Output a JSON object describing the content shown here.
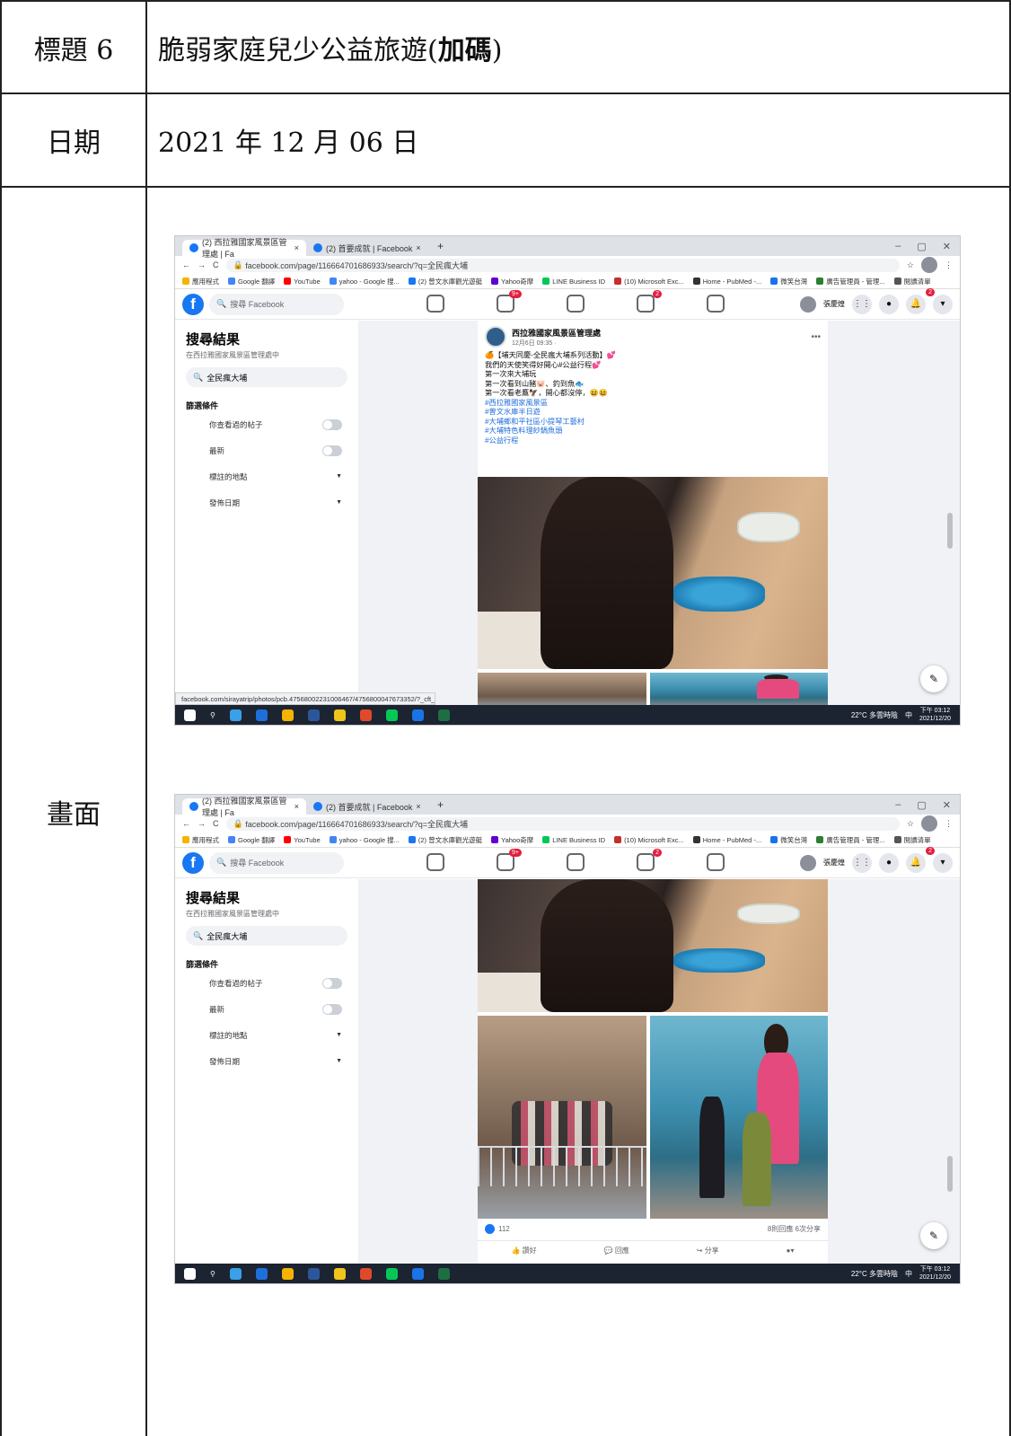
{
  "rows": {
    "title_label": "標題 6",
    "title_value_main": "脆弱家庭兒少公益旅遊(",
    "title_value_bold": "加碼",
    "title_value_end": ")",
    "date_label": "日期",
    "date_value": "2021 年 12 月 06 日",
    "screen_label": "畫面"
  },
  "browser": {
    "tab1": "(2) 西拉雅國家風景區管理處 | Fa",
    "tab2": "(2) 首要成就 | Facebook",
    "url_1": "facebook.com/page/116664701686933/search/?q=全民瘋大埔",
    "url_2": "facebook.com/page/116664701686933/search/?q=全民瘋大埔",
    "bookmarks": [
      "應用程式",
      "Google 翻譯",
      "YouTube",
      "yahoo - Google 搜...",
      "(2) 曾文水庫觀光遊艇",
      "Yahoo奇摩",
      "LINE Business ID",
      "(10) Microsoft Exc...",
      "Home - PubMed -...",
      "微笑台灣",
      "廣告管理員 - 管理...",
      "閱讀清單"
    ],
    "bookmark_colors": [
      "#f4b400",
      "#4285f4",
      "#ff0000",
      "#4285f4",
      "#1877f2",
      "#6001d2",
      "#06c755",
      "#c4302b",
      "#333333",
      "#1a73e8",
      "#2e7d32",
      "#555555"
    ]
  },
  "facebook": {
    "search_placeholder": "搜尋 Facebook",
    "watch_badge": "9+",
    "groups_badge": "2",
    "notif_badge": "2",
    "user_name": "張慶煌",
    "sidebar_title": "搜尋結果",
    "sidebar_sub": "在西拉雅國家風景區管理處中",
    "sidebar_query": "全民瘋大埔",
    "filter_title": "篩選條件",
    "filter_items": [
      "你查看過的帖子",
      "最新",
      "標註的地點",
      "發佈日期"
    ]
  },
  "post": {
    "page_name": "西拉雅國家風景區管理處",
    "time": "12月6日 09:35 · ",
    "lines": [
      "🍊【埔天同慶-全民瘋大埔系列活動】💕",
      "我們的天使笑得好開心#公益行程💕",
      "第一次來大埔玩",
      "第一次看到山豬🐷、釣到魚🐟",
      "第一次看老鷹🦅，開心都沒停，😆😆"
    ],
    "tags": [
      "#西拉雅國家風景區",
      "#曾文水庫半日遊",
      "#大埔鄉和平社區小提琴工藝村",
      "#大埔特色料理紗鍋魚頭",
      "#公益行程"
    ],
    "likes": "112",
    "comments_shares": "8則回應 6次分享",
    "action_like": "讚好",
    "action_comment": "回應",
    "action_share": "分享"
  },
  "status_link": "facebook.com/sirayatrip/photos/pcb.4756800223100646​7/4756800047673352/?_cft_[...",
  "taskbar": {
    "weather": "22°C 多雲時陰",
    "ime": "中",
    "time": "下午 03:12",
    "date": "2021/12/20"
  }
}
